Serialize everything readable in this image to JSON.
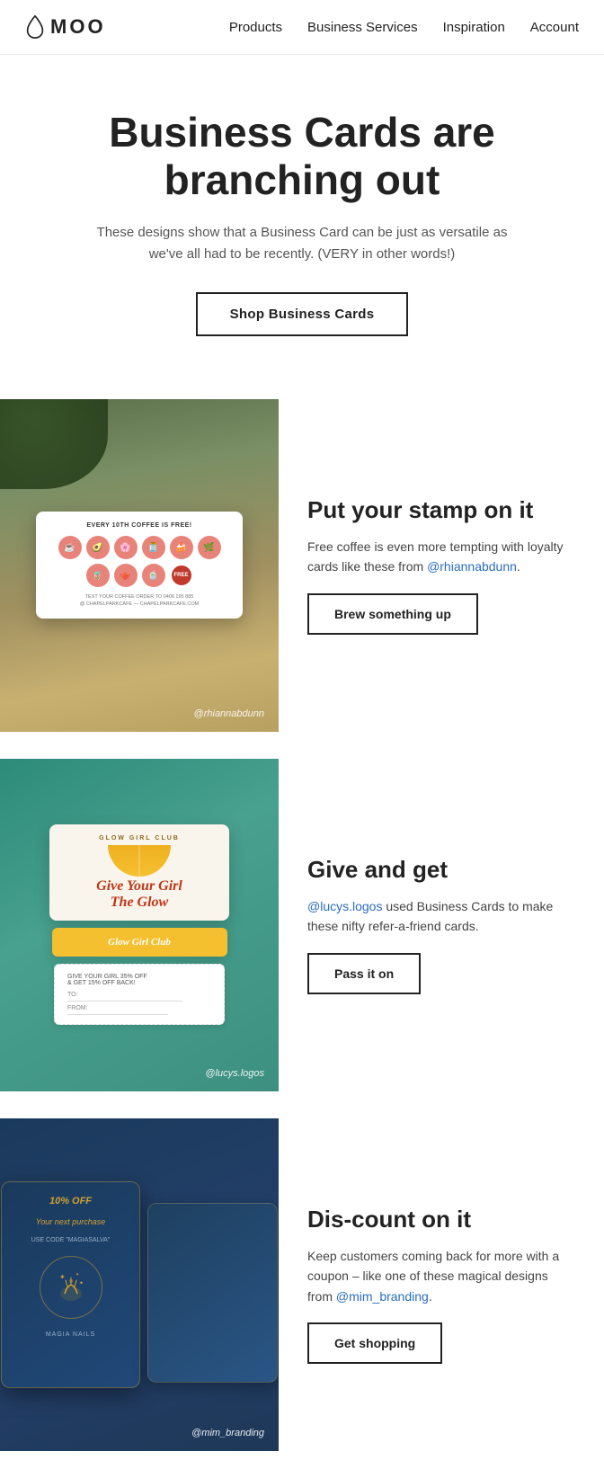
{
  "nav": {
    "logo_text": "MOO",
    "links": [
      {
        "label": "Products",
        "id": "products"
      },
      {
        "label": "Business Services",
        "id": "business-services"
      },
      {
        "label": "Inspiration",
        "id": "inspiration"
      },
      {
        "label": "Account",
        "id": "account"
      }
    ]
  },
  "hero": {
    "title": "Business Cards are branching out",
    "subtitle": "These designs show that a Business Card can be just as versatile as we've all had to be recently. (VERY in other words!)",
    "cta_label": "Shop Business Cards"
  },
  "sections": [
    {
      "id": "coffee",
      "title": "Put your stamp on it",
      "description_prefix": "Free coffee is even more tempting with loyalty cards like these from ",
      "link_text": "@rhiannabdunn",
      "link_href": "#rhiannabdunn",
      "description_suffix": ".",
      "cta_label": "Brew something up",
      "image_credit": "@rhiannabdunn"
    },
    {
      "id": "glow",
      "title": "Give and get",
      "description_prefix": "",
      "link_text": "@lucys.logos",
      "link_href": "#lucys.logos",
      "description_suffix": " used Business Cards to make these nifty refer-a-friend cards.",
      "cta_label": "Pass it on",
      "image_credit": "@lucys.logos"
    },
    {
      "id": "nails",
      "title": "Dis-count on it",
      "description_prefix": "Keep customers coming back for more with a coupon – like one of these magical designs from ",
      "link_text": "@mim_branding",
      "link_href": "#mim_branding",
      "description_suffix": ".",
      "cta_label": "Get shopping",
      "image_credit": "@mim_branding"
    }
  ]
}
